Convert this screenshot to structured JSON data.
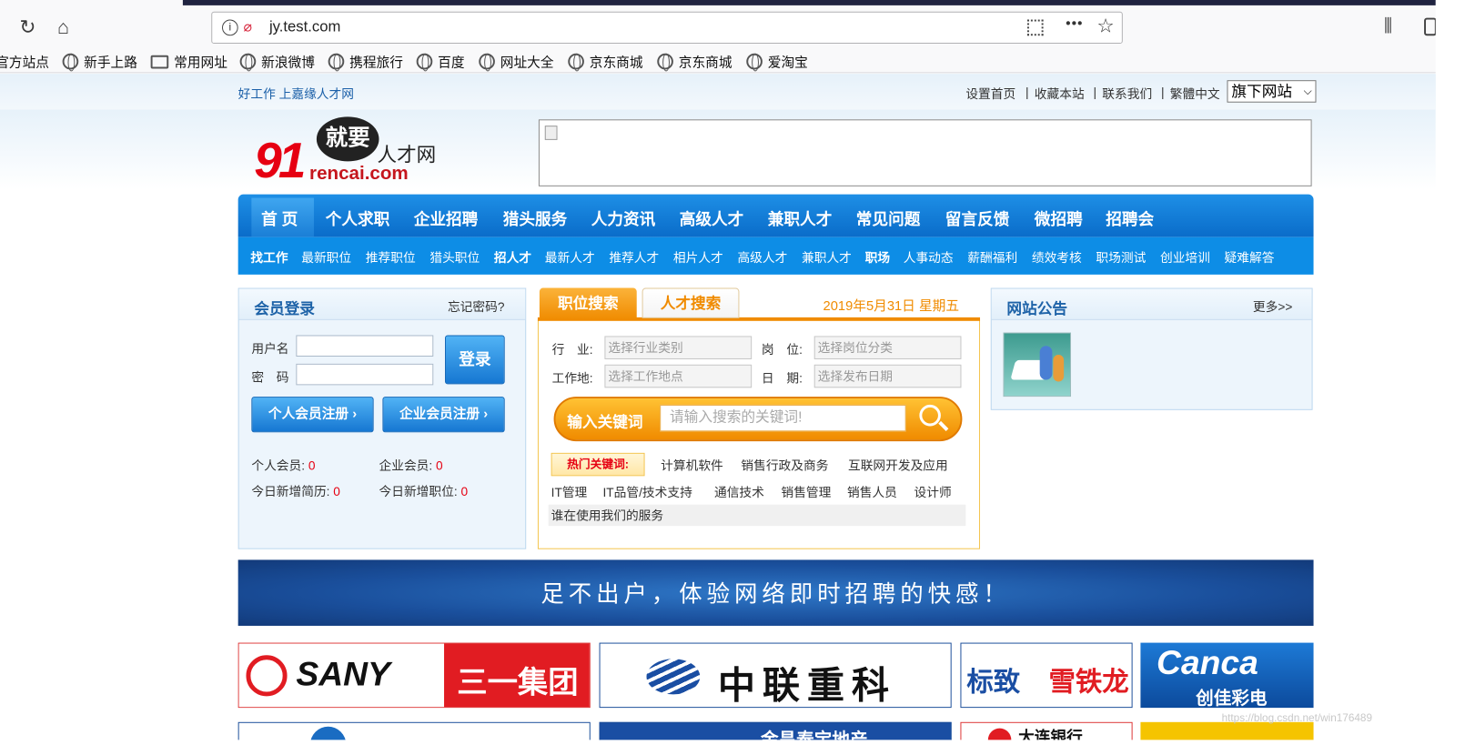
{
  "browser": {
    "url": "jy.test.com",
    "menu_dots": "•••",
    "bookmarks": [
      "官方站点",
      "新手上路",
      "常用网址",
      "新浪微博",
      "携程旅行",
      "百度",
      "网址大全",
      "京东商城",
      "京东商城",
      "爱淘宝"
    ]
  },
  "topbar": {
    "slogan": "好工作 上嘉缘人才网",
    "links": [
      "设置首页",
      "|",
      "收藏本站",
      "|",
      "联系我们",
      "|",
      "繁體中文"
    ],
    "site_select": "旗下网站"
  },
  "logo": {
    "num": "91",
    "big": "就要",
    "name": "人才网",
    "domain": "rencai.com"
  },
  "nav": {
    "main": [
      "首 页",
      "个人求职",
      "企业招聘",
      "猎头服务",
      "人力资讯",
      "高级人才",
      "兼职人才",
      "常见问题",
      "留言反馈",
      "微招聘",
      "招聘会"
    ],
    "sub": [
      "找工作",
      "最新职位",
      "推荐职位",
      "猎头职位",
      "招人才",
      "最新人才",
      "推荐人才",
      "相片人才",
      "高级人才",
      "兼职人才",
      "职场",
      "人事动态",
      "薪酬福利",
      "绩效考核",
      "职场测试",
      "创业培训",
      "疑难解答"
    ]
  },
  "login": {
    "title": "会员登录",
    "forgot": "忘记密码?",
    "username_label": "用户名",
    "password_label": "密　码",
    "login_button": "登录",
    "personal_register": "个人会员注册",
    "company_register": "企业会员注册",
    "stats": {
      "personal_label": "个人会员:",
      "personal_value": "0",
      "company_label": "企业会员:",
      "company_value": "0",
      "resume_label": "今日新增简历:",
      "resume_value": "0",
      "job_label": "今日新增职位:",
      "job_value": "0"
    }
  },
  "search": {
    "tab_jobs": "职位搜索",
    "tab_talent": "人才搜索",
    "date": "2019年5月31日 星期五",
    "industry_label": "行　业:",
    "industry_value": "选择行业类别",
    "position_label": "岗　位:",
    "position_value": "选择岗位分类",
    "location_label": "工作地:",
    "location_value": "选择工作地点",
    "date_label": "日　期:",
    "date_value": "选择发布日期",
    "keyword_label": "输入关键词",
    "keyword_placeholder": "请输入搜索的关键词!",
    "hot_label": "热门关键词:",
    "hot_keywords_row1": [
      "计算机软件",
      "销售行政及商务",
      "互联网开发及应用"
    ],
    "hot_keywords_row2": [
      "IT管理",
      "IT品管/技术支持",
      "通信技术",
      "销售管理",
      "销售人员",
      "设计师"
    ],
    "service_text": "谁在使用我们的服务"
  },
  "notice": {
    "title": "网站公告",
    "more": "更多>>"
  },
  "big_banner": {
    "text": "足不出户，体验网络即时招聘的快感！"
  },
  "companies": {
    "sany_en": "SANY",
    "sany_cn": "三一集团",
    "zoomlion": "中联重科",
    "peugeot": "标致",
    "citroen": "雪铁龙",
    "canca": "Canca",
    "canca_cn": "创佳彩电",
    "row2_b": "金昌泰宝地产",
    "row2_c": "大连银行"
  },
  "watermark": "https://blog.csdn.net/win176489",
  "colors": {
    "nav_blue": "#0d8de6",
    "orange": "#f08b00",
    "red": "#e60012",
    "link_blue": "#1a5fa8"
  }
}
